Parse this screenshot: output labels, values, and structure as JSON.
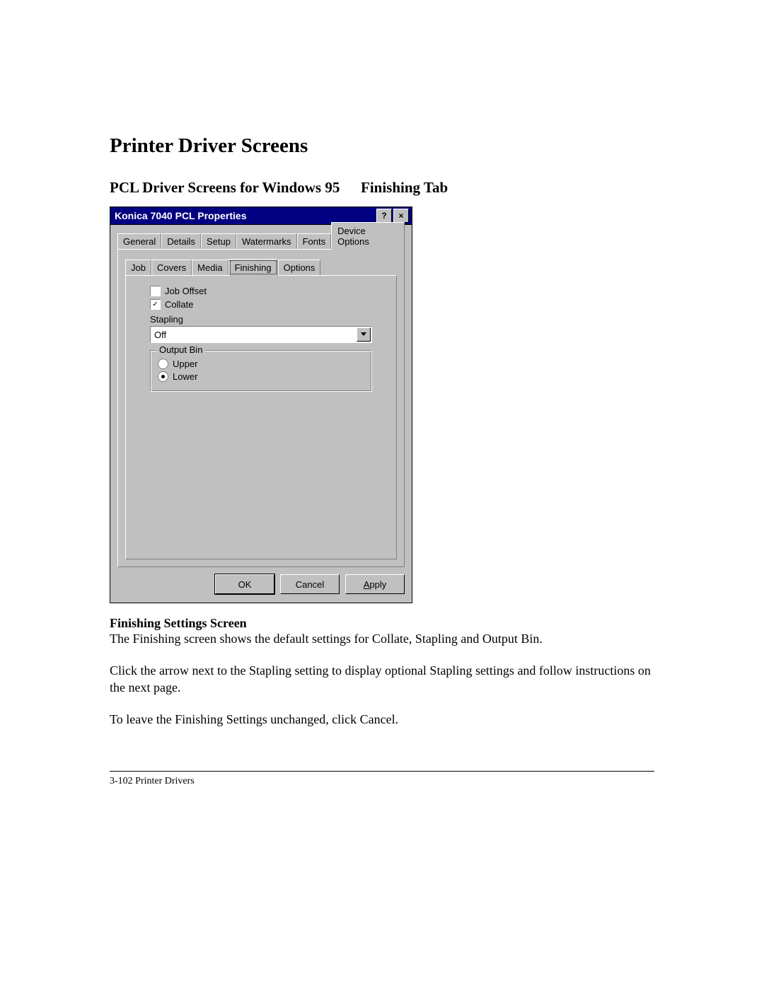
{
  "page": {
    "title": "Printer Driver Screens",
    "subtitle_left": "PCL Driver Screens for Windows 95",
    "subtitle_right": "Finishing Tab",
    "section_heading": "Finishing Settings Screen",
    "para1": "The Finishing screen shows the default settings for Collate, Stapling and Output Bin.",
    "para2": "Click the arrow next to the Stapling setting to display optional Stapling settings and follow instructions on the next page.",
    "para3": "To leave the Finishing Settings unchanged, click Cancel.",
    "footer": "3-102 Printer Drivers"
  },
  "dialog": {
    "title": "Konica 7040 PCL Properties",
    "help_glyph": "?",
    "close_glyph": "×",
    "tabs_outer": [
      "General",
      "Details",
      "Setup",
      "Watermarks",
      "Fonts",
      "Device Options"
    ],
    "tabs_outer_active_index": 5,
    "tabs_inner": [
      "Job",
      "Covers",
      "Media",
      "Finishing",
      "Options"
    ],
    "tabs_inner_active_index": 3,
    "job_offset_label": "Job Offset",
    "job_offset_checked": false,
    "collate_label": "Collate",
    "collate_checked": true,
    "collate_mark": "✓",
    "stapling_label": "Stapling",
    "stapling_value": "Off",
    "output_bin_legend": "Output Bin",
    "output_upper": "Upper",
    "output_lower": "Lower",
    "output_selected": "Lower",
    "btn_ok": "OK",
    "btn_cancel": "Cancel",
    "btn_apply_prefix": "A",
    "btn_apply_rest": "pply"
  }
}
